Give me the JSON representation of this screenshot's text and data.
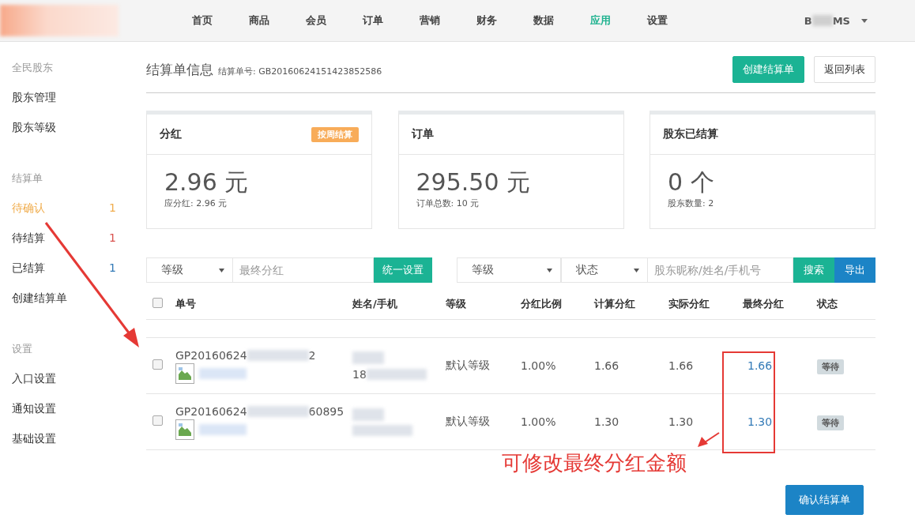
{
  "nav": {
    "items": [
      {
        "label": "首页",
        "selected": false
      },
      {
        "label": "商品",
        "selected": false
      },
      {
        "label": "会员",
        "selected": false
      },
      {
        "label": "订单",
        "selected": false
      },
      {
        "label": "营销",
        "selected": false
      },
      {
        "label": "财务",
        "selected": false
      },
      {
        "label": "数据",
        "selected": false
      },
      {
        "label": "应用",
        "selected": true
      },
      {
        "label": "设置",
        "selected": false
      }
    ],
    "user_prefix": "B",
    "user_suffix": "MS"
  },
  "sidebar": {
    "groups": [
      {
        "title": "全民股东",
        "items": [
          {
            "label": "股东管理",
            "selected": false
          },
          {
            "label": "股东等级",
            "selected": false
          }
        ]
      },
      {
        "title": "结算单",
        "items": [
          {
            "label": "待确认",
            "selected": true,
            "count": "1",
            "color": "#f0ad4e"
          },
          {
            "label": "待结算",
            "selected": false,
            "count": "1",
            "color": "#d9534f"
          },
          {
            "label": "已结算",
            "selected": false,
            "count": "1",
            "color": "#337ab7"
          },
          {
            "label": "创建结算单",
            "selected": false
          }
        ]
      },
      {
        "title": "设置",
        "items": [
          {
            "label": "入口设置",
            "selected": false
          },
          {
            "label": "通知设置",
            "selected": false
          },
          {
            "label": "基础设置",
            "selected": false
          }
        ]
      }
    ]
  },
  "header": {
    "title": "结算单信息",
    "number_label": "结算单号: GB20160624151423852586",
    "buttons": [
      {
        "label": "创建结算单",
        "kind": "primary"
      },
      {
        "label": "返回列表",
        "kind": "default"
      }
    ]
  },
  "cards": [
    {
      "title": "分红",
      "badge": "按周结算",
      "value": "2.96 元",
      "note": "应分红: 2.96 元"
    },
    {
      "title": "订单",
      "value": "295.50 元",
      "note": "订单总数: 10 元"
    },
    {
      "title": "股东已结算",
      "value": "0 个",
      "note": "股东数量: 2"
    }
  ],
  "filters_left": {
    "select": "等级",
    "placeholder": "最终分红",
    "button": "统一设置"
  },
  "filters_right": {
    "selects": [
      "等级",
      "状态"
    ],
    "placeholder": "股东昵称/姓名/手机号",
    "buttons": [
      {
        "label": "搜索",
        "kind": "green"
      },
      {
        "label": "导出",
        "kind": "blue"
      }
    ]
  },
  "table": {
    "select_all_checked": false,
    "columns": [
      "单号",
      "姓名/手机",
      "等级",
      "分红比例",
      "计算分红",
      "实际分红",
      "最终分红",
      "状态"
    ],
    "rows": [
      {
        "checked": false,
        "order_prefix": "GP20160624",
        "order_suffix": "2",
        "phone_prefix": "18",
        "level": "默认等级",
        "ratio": "1.00%",
        "computed": "1.66",
        "actual": "1.66",
        "final": "1.66",
        "status": "等待"
      },
      {
        "checked": false,
        "order_prefix": "GP20160624",
        "order_suffix": "60895",
        "level": "默认等级",
        "ratio": "1.00%",
        "computed": "1.30",
        "actual": "1.30",
        "final": "1.30",
        "status": "等待"
      }
    ]
  },
  "annotation": "可修改最终分红金额",
  "confirm_button": "确认结算单"
}
